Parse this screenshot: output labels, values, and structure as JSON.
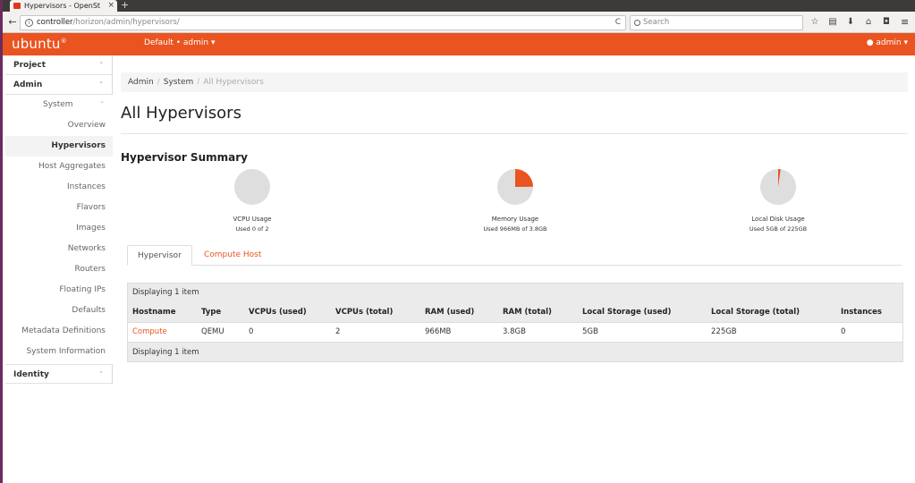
{
  "browser": {
    "tab_title": "Hypervisors - OpenSt",
    "tab_close": "×",
    "new_tab": "+",
    "back": "←",
    "info": "i",
    "url_host": "controller",
    "url_path": "/horizon/admin/hypervisors/",
    "reload": "C",
    "search_placeholder": "Search",
    "icons": [
      "star-icon",
      "reading-list-icon",
      "download-icon",
      "home-icon",
      "pocket-icon"
    ],
    "menu": "≡"
  },
  "header": {
    "brand": "ubuntu",
    "brand_mark": "®",
    "project_switcher": "Default • admin ▾",
    "user_menu": "admin ▾",
    "accent_color": "#e95420"
  },
  "sidebar": {
    "project": "Project",
    "admin": "Admin",
    "system": "System",
    "items": [
      "Overview",
      "Hypervisors",
      "Host Aggregates",
      "Instances",
      "Flavors",
      "Images",
      "Networks",
      "Routers",
      "Floating IPs",
      "Defaults",
      "Metadata Definitions",
      "System Information"
    ],
    "identity": "Identity",
    "chevron_down": "˅",
    "chevron_up": "˄"
  },
  "breadcrumb": {
    "items": [
      "Admin",
      "System",
      "All Hypervisors"
    ],
    "sep": "/"
  },
  "page": {
    "title": "All Hypervisors",
    "summary_title": "Hypervisor Summary"
  },
  "summary": [
    {
      "label": "VCPU Usage",
      "detail": "Used 0 of 2",
      "fraction": 0.0
    },
    {
      "label": "Memory Usage",
      "detail": "Used 966MB of 3.8GB",
      "fraction": 0.248
    },
    {
      "label": "Local Disk Usage",
      "detail": "Used 5GB of 225GB",
      "fraction": 0.022
    }
  ],
  "tabs": {
    "hypervisor": "Hypervisor",
    "compute_host": "Compute Host"
  },
  "table": {
    "info_top": "Displaying 1 item",
    "info_bottom": "Displaying 1 item",
    "columns": [
      "Hostname",
      "Type",
      "VCPUs (used)",
      "VCPUs (total)",
      "RAM (used)",
      "RAM (total)",
      "Local Storage (used)",
      "Local Storage (total)",
      "Instances"
    ],
    "rows": [
      [
        "Compute",
        "QEMU",
        "0",
        "2",
        "966MB",
        "3.8GB",
        "5GB",
        "225GB",
        "0"
      ]
    ]
  }
}
